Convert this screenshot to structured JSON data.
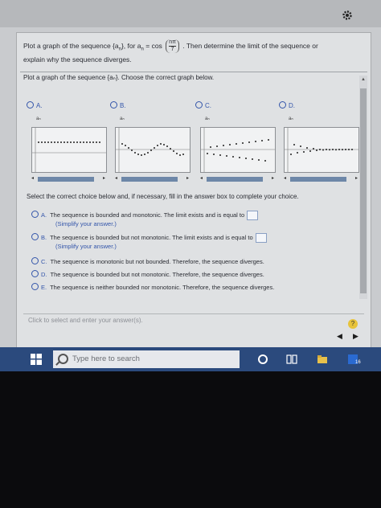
{
  "question": {
    "text_before": "Plot a graph of the sequence {a",
    "text_sub_n": "n",
    "text_mid": "}, for a",
    "text_eq": " = cos",
    "frac_num": "nπ",
    "frac_den": "7",
    "text_after": ". Then determine the limit of the sequence or",
    "line2": "explain why the sequence diverges."
  },
  "part1": {
    "instruction": "Plot a graph of the sequence {aₙ}. Choose the correct graph below.",
    "options": [
      {
        "letter": "A.",
        "axis_label": "aₙ"
      },
      {
        "letter": "B.",
        "axis_label": "aₙ"
      },
      {
        "letter": "C.",
        "axis_label": "aₙ"
      },
      {
        "letter": "D.",
        "axis_label": "aₙ"
      }
    ]
  },
  "part2": {
    "instruction": "Select the correct choice below and, if necessary, fill in the answer box to complete your choice.",
    "choices": [
      {
        "letter": "A.",
        "text": "The sequence is bounded and monotonic. The limit exists and is equal to",
        "hint": "(Simplify your answer.)"
      },
      {
        "letter": "B.",
        "text": "The sequence is bounded but not monotonic. The limit exists and is equal to",
        "hint": "(Simplify your answer.)"
      },
      {
        "letter": "C.",
        "text": "The sequence is monotonic but not bounded. Therefore, the sequence diverges.",
        "hint": ""
      },
      {
        "letter": "D.",
        "text": "The sequence is bounded but not monotonic. Therefore, the sequence diverges.",
        "hint": ""
      },
      {
        "letter": "E.",
        "text": "The sequence is neither bounded nor monotonic. Therefore, the sequence diverges.",
        "hint": ""
      }
    ]
  },
  "footer": {
    "placeholder": "Click to select and enter your answer(s).",
    "help": "?"
  },
  "taskbar": {
    "search_placeholder": "Type here to search",
    "badge": "16"
  },
  "colors": {
    "accent": "#3355aa",
    "taskbar": "#2b4a7d",
    "help": "#e7c33b"
  }
}
